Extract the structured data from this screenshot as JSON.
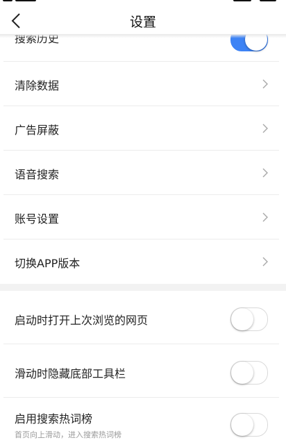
{
  "header": {
    "title": "设置"
  },
  "settings": {
    "search_history": {
      "label": "搜索历史",
      "on": true
    },
    "links": [
      {
        "label": "清除数据"
      },
      {
        "label": "广告屏蔽"
      },
      {
        "label": "语音搜索"
      },
      {
        "label": "账号设置"
      },
      {
        "label": "切换APP版本"
      }
    ],
    "toggles": [
      {
        "label": "启动时打开上次浏览的网页",
        "on": false
      },
      {
        "label": "滑动时隐藏底部工具栏",
        "on": false
      },
      {
        "label": "启用搜索热词榜",
        "sublabel": "首页向上滑动，进入搜索热词榜",
        "on": false
      }
    ]
  },
  "colors": {
    "accent": "#3d83f5",
    "divider": "#ececec",
    "section_gap": "#f2f2f2"
  },
  "icons": {
    "back": "chevron-left-icon",
    "row_arrow": "chevron-right-icon"
  }
}
